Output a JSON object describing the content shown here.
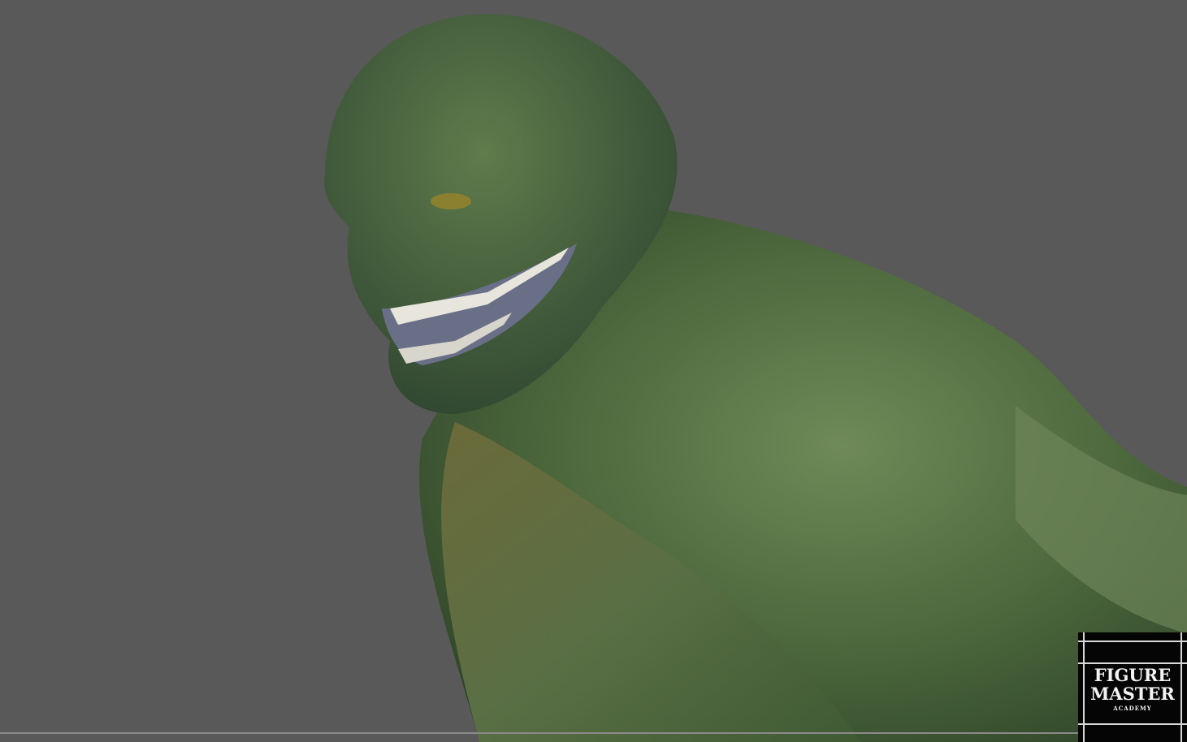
{
  "viewport": {
    "background_color": "#595959",
    "skin_color": "#4f6a3c"
  },
  "logo": {
    "line1": "FIGURE",
    "line2": "MASTER",
    "line3": "ACADEMY"
  }
}
